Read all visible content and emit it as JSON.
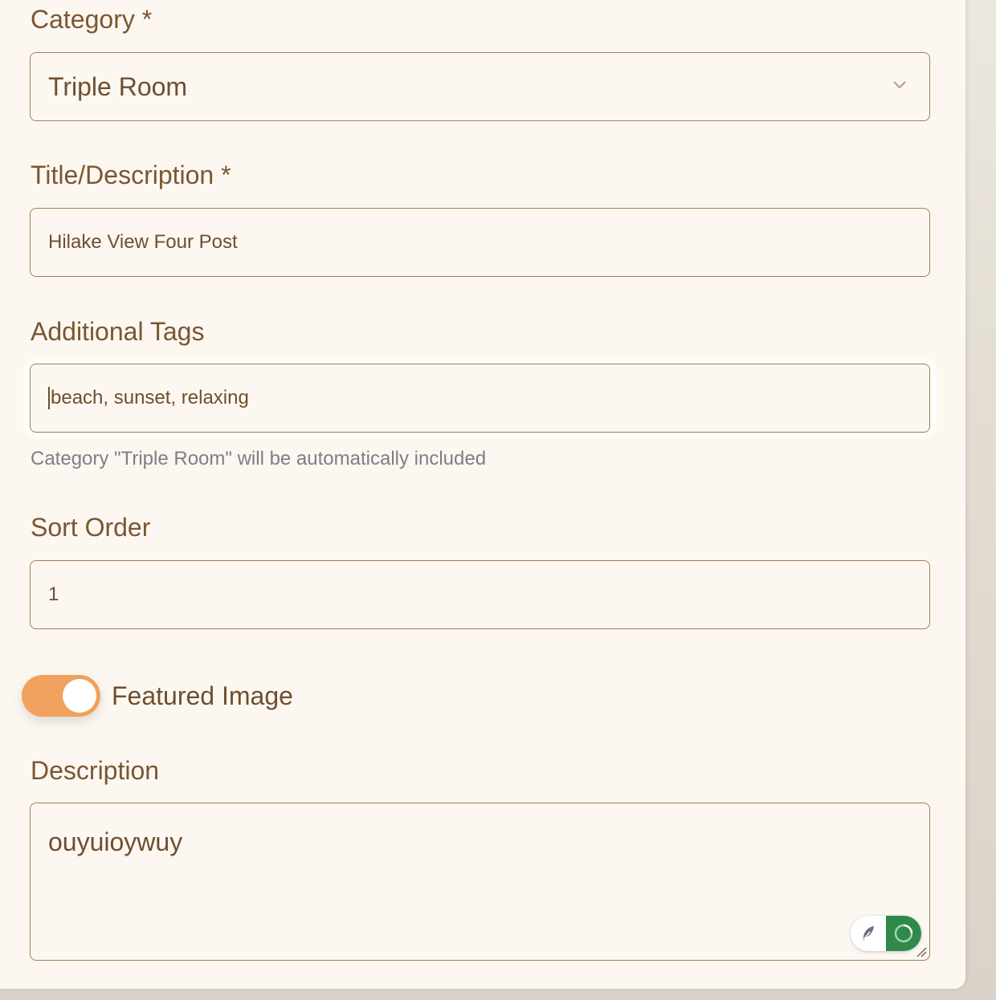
{
  "category": {
    "label": "Category *",
    "value": "Triple Room"
  },
  "title": {
    "label": "Title/Description *",
    "value": "Hilake View Four Post"
  },
  "tags": {
    "label": "Additional Tags",
    "value": "beach, sunset, relaxing",
    "hint": "Category \"Triple Room\" will be automatically included"
  },
  "sort": {
    "label": "Sort Order",
    "value": "1"
  },
  "featured": {
    "label": "Featured Image",
    "enabled": true
  },
  "description": {
    "label": "Description",
    "value": "ouyuioywuy"
  },
  "colors": {
    "accent": "#f0a15e",
    "border": "#a37f55",
    "text": "#6e4f2e",
    "widget_green": "#2f8a4a"
  },
  "icons": [
    "chevron-down-icon",
    "feather-icon",
    "loading-spinner-icon",
    "resize-handle-icon"
  ]
}
